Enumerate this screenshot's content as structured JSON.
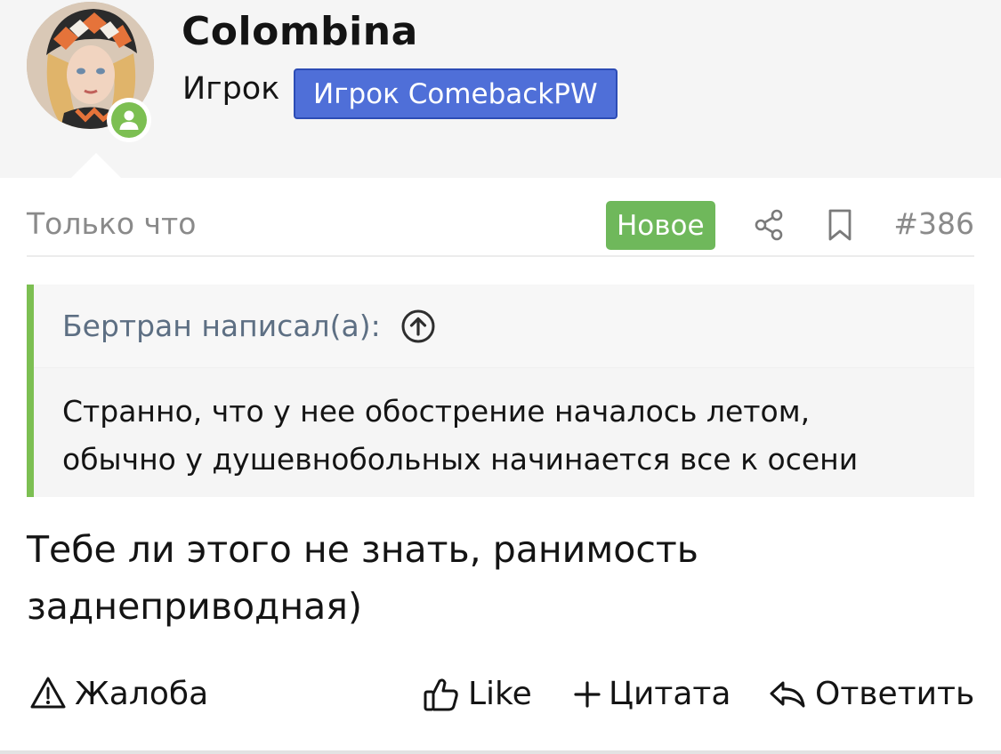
{
  "user": {
    "name": "Colombina",
    "title": "Игрок",
    "banner": "Игрок ComebackPW",
    "avatar_icon": "avatar-doll-image",
    "status_icon": "online-user-icon",
    "status_color": "#7cbf52",
    "banner_color": "#4f6fd8"
  },
  "post": {
    "time": "Только что",
    "new_label": "Новое",
    "new_color": "#6fb85b",
    "share_icon": "share-icon",
    "bookmark_icon": "bookmark-icon",
    "number": "#386"
  },
  "quote": {
    "author": "Бертран написал(а):",
    "jump_icon": "arrow-up-circle-icon",
    "line1": "Странно, что у нее обострение началось летом,",
    "line2": "обычно у душевнобольных начинается все к осени",
    "accent_color": "#7cbf52"
  },
  "message": {
    "line1": "Тебе ли этого не знать, ранимость",
    "line2": "заднеприводная)"
  },
  "actions": {
    "report": "Жалоба",
    "like": "Like",
    "quote": "Цитата",
    "reply": "Ответить"
  }
}
